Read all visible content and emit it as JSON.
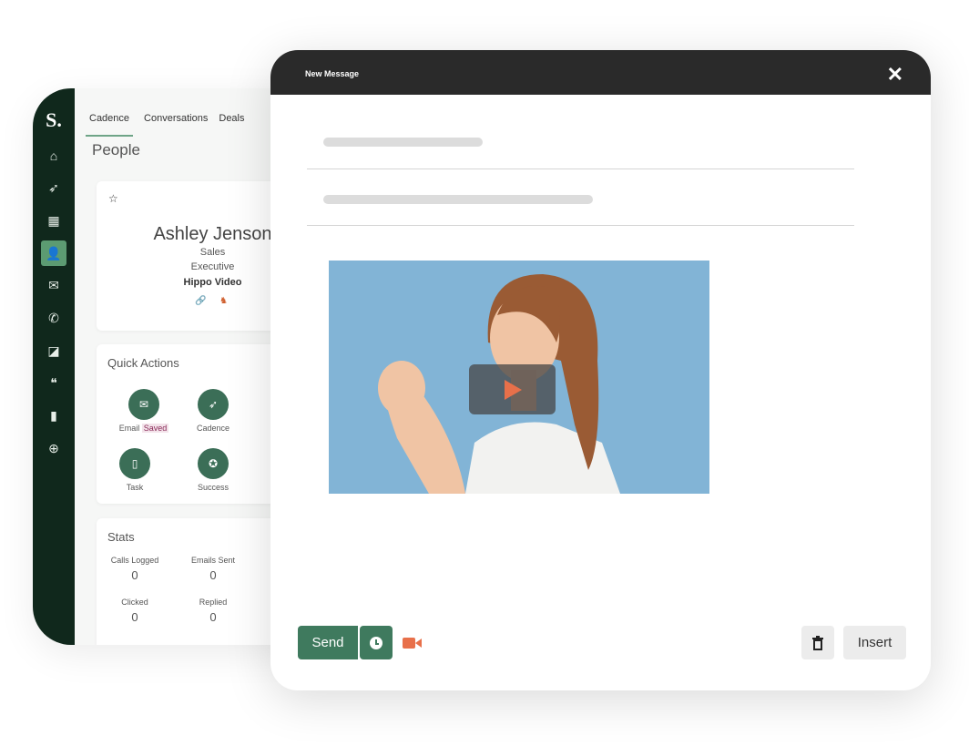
{
  "crm": {
    "logo": "S.",
    "sidebar": [
      {
        "icon": "home-icon",
        "glyph": "⌂"
      },
      {
        "icon": "rocket-icon",
        "glyph": "➶"
      },
      {
        "icon": "building-icon",
        "glyph": "▦"
      },
      {
        "icon": "person-icon",
        "glyph": "👤",
        "active": true
      },
      {
        "icon": "mail-icon",
        "glyph": "✉"
      },
      {
        "icon": "phone-icon",
        "glyph": "✆"
      },
      {
        "icon": "document-icon",
        "glyph": "◪"
      },
      {
        "icon": "quote-icon",
        "glyph": "❝"
      },
      {
        "icon": "chart-icon",
        "glyph": "▮"
      },
      {
        "icon": "target-icon",
        "glyph": "⊕"
      }
    ],
    "tabs": [
      "Cadence",
      "Conversations",
      "Deals"
    ],
    "page_title": "People",
    "contact": {
      "name": "Ashley Jenson",
      "title_line1": "Sales",
      "title_line2": "Executive",
      "company": "Hippo Video"
    },
    "quick_actions": {
      "title": "Quick Actions",
      "items": [
        {
          "label": "Email",
          "badge": "Saved"
        },
        {
          "label": "Cadence"
        },
        {
          "label": "Task"
        },
        {
          "label": "Success"
        }
      ]
    },
    "stats": {
      "title": "Stats",
      "items": [
        {
          "label": "Calls Logged",
          "value": "0"
        },
        {
          "label": "Emails Sent",
          "value": "0"
        },
        {
          "label": "Clicked",
          "value": "0"
        },
        {
          "label": "Replied",
          "value": "0"
        }
      ]
    }
  },
  "message": {
    "title": "New Message",
    "close": "✕",
    "send": "Send",
    "insert": "Insert"
  },
  "colors": {
    "sidebar": "#10281c",
    "accent": "#3f7a5e",
    "video_icon": "#e8704a"
  }
}
